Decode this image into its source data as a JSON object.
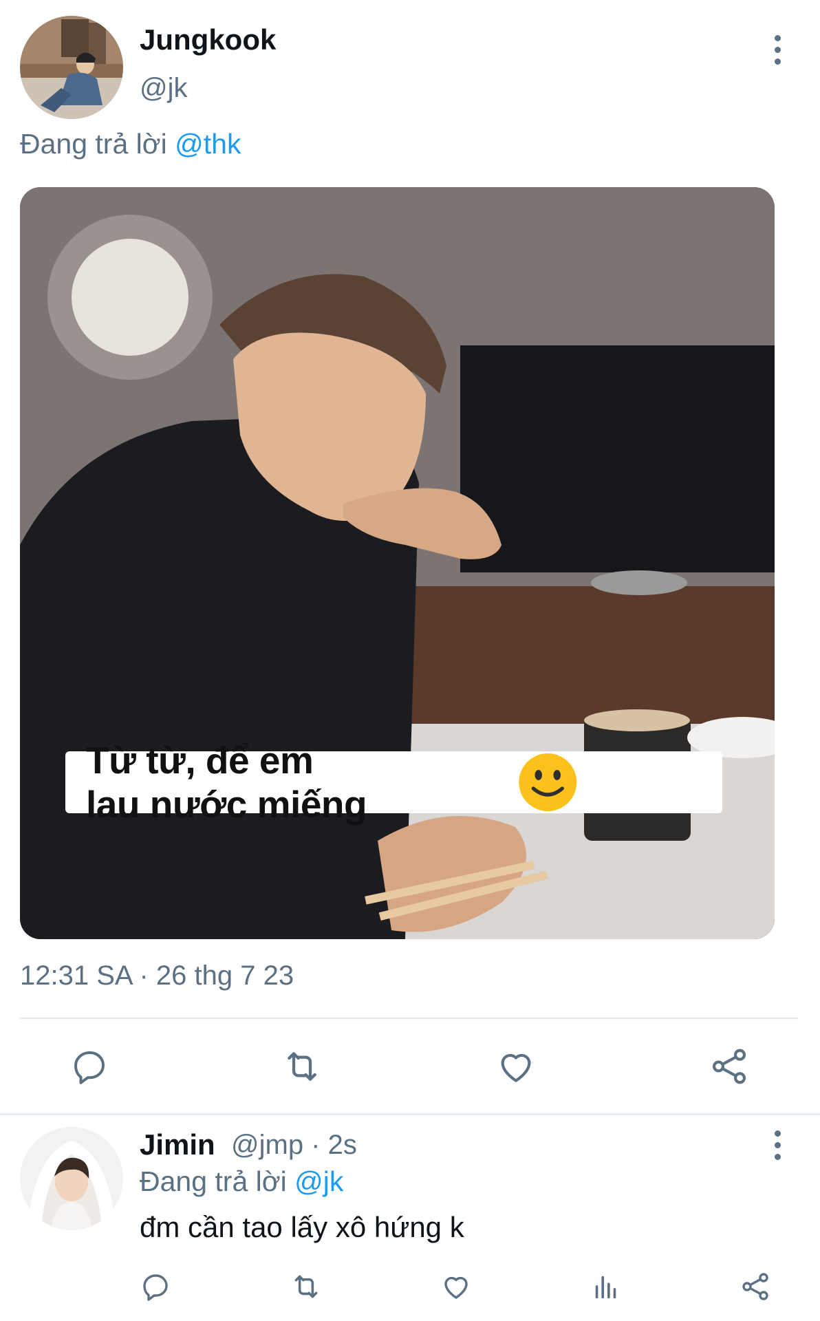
{
  "tweet": {
    "author_name": "Jungkook",
    "author_handle": "@jk",
    "replying_prefix": "Đang trả lời",
    "replying_to": "@thk",
    "image_caption": "Từ từ, để em lau nước miếng",
    "timestamp": "12:31 SA · 26 thg 7 23",
    "actions": [
      "reply-icon",
      "retweet-icon",
      "like-icon",
      "share-icon"
    ]
  },
  "reply": {
    "author_name": "Jimin",
    "meta": "@jmp · 2s",
    "replying_prefix": "Đang trả lời",
    "replying_to": "@jk",
    "text": "đm cần tao lấy xô hứng k",
    "actions": [
      "reply-icon",
      "retweet-icon",
      "like-icon",
      "analytics-icon",
      "share-icon"
    ]
  },
  "colors": {
    "text_primary": "#0f1419",
    "text_secondary": "#5b7083",
    "accent": "#1d9bf0",
    "divider": "#e1e8ed"
  }
}
